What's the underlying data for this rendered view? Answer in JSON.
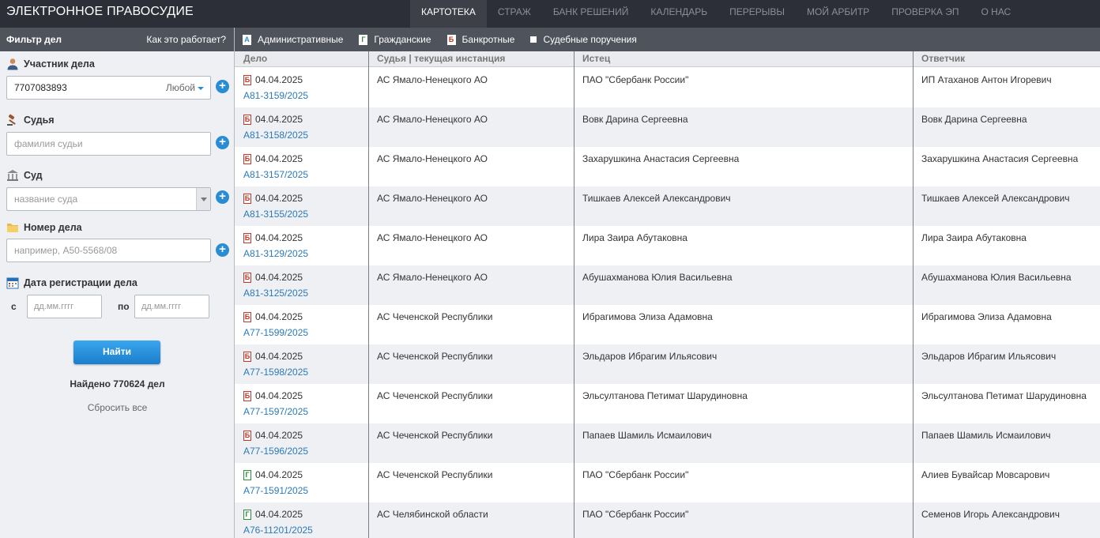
{
  "header": {
    "logo": "ЭЛЕКТРОННОЕ ПРАВОСУДИЕ",
    "nav": [
      {
        "label": "КАРТОТЕКА",
        "active": true
      },
      {
        "label": "СТРАЖ",
        "active": false
      },
      {
        "label": "БАНК РЕШЕНИЙ",
        "active": false
      },
      {
        "label": "КАЛЕНДАРЬ",
        "active": false
      },
      {
        "label": "ПЕРЕРЫВЫ",
        "active": false
      },
      {
        "label": "МОЙ АРБИТР",
        "active": false
      },
      {
        "label": "ПРОВЕРКА ЭП",
        "active": false
      },
      {
        "label": "О НАС",
        "active": false
      }
    ]
  },
  "filter": {
    "title": "Фильтр дел",
    "how_link": "Как это работает?",
    "participant": {
      "label": "Участник дела",
      "value": "7707083893",
      "role": "Любой"
    },
    "judge": {
      "label": "Судья",
      "placeholder": "фамилия судьи"
    },
    "court": {
      "label": "Суд",
      "placeholder": "название суда"
    },
    "case_number": {
      "label": "Номер дела",
      "placeholder": "например, А50-5568/08"
    },
    "reg_date": {
      "label": "Дата регистрации дела",
      "from_label": "с",
      "to_label": "по",
      "from_placeholder": "дд.мм.гггг",
      "to_placeholder": "дд.мм.гггг"
    },
    "find_button": "Найти",
    "found_text": "Найдено 770624 дел",
    "reset_link": "Сбросить все"
  },
  "case_types": [
    {
      "label": "Административные",
      "letter": "А",
      "color": "#2a8dd4"
    },
    {
      "label": "Гражданские",
      "letter": "Г",
      "color": "#2e8b3c"
    },
    {
      "label": "Банкротные",
      "letter": "Б",
      "color": "#c0392b"
    },
    {
      "label": "Судебные поручения",
      "letter": "",
      "color": "#ffffff"
    }
  ],
  "table": {
    "columns": [
      "Дело",
      "Судья | текущая инстанция",
      "Истец",
      "Ответчик"
    ],
    "rows": [
      {
        "type": "Б",
        "date": "04.04.2025",
        "number": "А81-3159/2025",
        "court": "АС Ямало-Ненецкого АО",
        "plaintiff": "ПАО \"Сбербанк России\"",
        "defendant": "ИП Атаханов Антон Игоревич"
      },
      {
        "type": "Б",
        "date": "04.04.2025",
        "number": "А81-3158/2025",
        "court": "АС Ямало-Ненецкого АО",
        "plaintiff": "Вовк Дарина Сергеевна",
        "defendant": "Вовк Дарина Сергеевна"
      },
      {
        "type": "Б",
        "date": "04.04.2025",
        "number": "А81-3157/2025",
        "court": "АС Ямало-Ненецкого АО",
        "plaintiff": "Захарушкина Анастасия Сергеевна",
        "defendant": "Захарушкина Анастасия Сергеевна"
      },
      {
        "type": "Б",
        "date": "04.04.2025",
        "number": "А81-3155/2025",
        "court": "АС Ямало-Ненецкого АО",
        "plaintiff": "Тишкаев Алексей Александрович",
        "defendant": "Тишкаев Алексей Александрович"
      },
      {
        "type": "Б",
        "date": "04.04.2025",
        "number": "А81-3129/2025",
        "court": "АС Ямало-Ненецкого АО",
        "plaintiff": "Лира Заира Абутаковна",
        "defendant": "Лира Заира Абутаковна"
      },
      {
        "type": "Б",
        "date": "04.04.2025",
        "number": "А81-3125/2025",
        "court": "АС Ямало-Ненецкого АО",
        "plaintiff": "Абушахманова Юлия Васильевна",
        "defendant": "Абушахманова Юлия Васильевна"
      },
      {
        "type": "Б",
        "date": "04.04.2025",
        "number": "А77-1599/2025",
        "court": "АС Чеченской Республики",
        "plaintiff": "Ибрагимова Элиза Адамовна",
        "defendant": "Ибрагимова Элиза Адамовна"
      },
      {
        "type": "Б",
        "date": "04.04.2025",
        "number": "А77-1598/2025",
        "court": "АС Чеченской Республики",
        "plaintiff": "Эльдаров Ибрагим Ильясович",
        "defendant": "Эльдаров Ибрагим Ильясович"
      },
      {
        "type": "Б",
        "date": "04.04.2025",
        "number": "А77-1597/2025",
        "court": "АС Чеченской Республики",
        "plaintiff": "Эльсултанова Петимат Шарудиновна",
        "defendant": "Эльсултанова Петимат Шарудиновна"
      },
      {
        "type": "Б",
        "date": "04.04.2025",
        "number": "А77-1596/2025",
        "court": "АС Чеченской Республики",
        "plaintiff": "Папаев Шамиль Исмаилович",
        "defendant": "Папаев Шамиль Исмаилович"
      },
      {
        "type": "Г",
        "date": "04.04.2025",
        "number": "А77-1591/2025",
        "court": "АС Чеченской Республики",
        "plaintiff": "ПАО \"Сбербанк России\"",
        "defendant": "Алиев Бувайсар Мовсарович"
      },
      {
        "type": "Г",
        "date": "04.04.2025",
        "number": "А76-11201/2025",
        "court": "АС Челябинской области",
        "plaintiff": "ПАО \"Сбербанк России\"",
        "defendant": "Семенов Игорь Александрович"
      }
    ]
  }
}
